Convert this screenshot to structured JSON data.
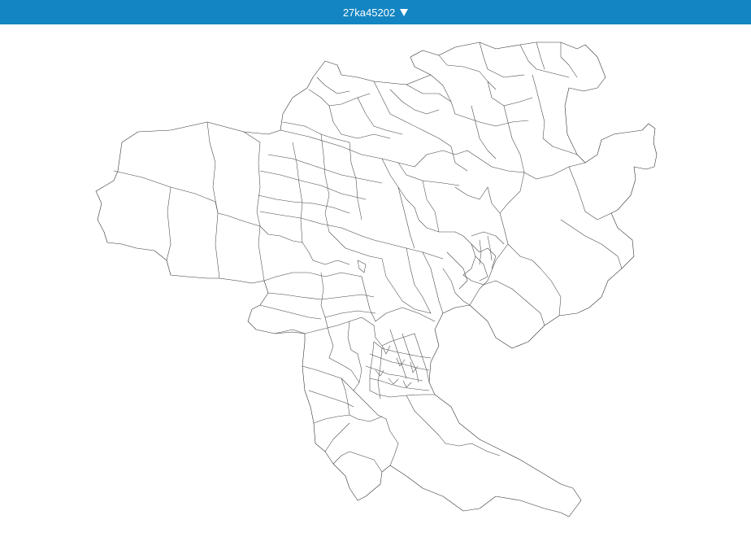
{
  "header": {
    "selector_label": "27ka45202",
    "background_color": "#1385c2",
    "dropdown_icon": "triangle-down-icon"
  },
  "map": {
    "fill_color": "#ffffff",
    "border_color": "#333333"
  }
}
